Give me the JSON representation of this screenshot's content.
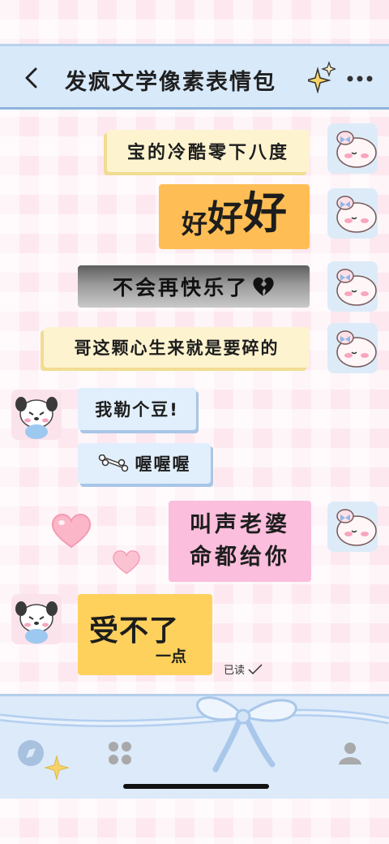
{
  "header": {
    "title": "发疯文学像素表情包"
  },
  "messages": [
    {
      "side": "right",
      "text": "宝的冷酷零下八度"
    },
    {
      "side": "right",
      "text_small": "好",
      "text_mid": "好",
      "text_big": "好"
    },
    {
      "side": "right",
      "text": "不会再快乐了",
      "icon": "broken-heart-icon"
    },
    {
      "side": "right",
      "text": "哥这颗心生来就是要碎的"
    },
    {
      "side": "left",
      "text": "我勒个豆!"
    },
    {
      "side": "left",
      "text": "喔喔喔",
      "icon": "bone-icon"
    },
    {
      "side": "right",
      "line1": "叫声老婆",
      "line2": "命都给你"
    },
    {
      "side": "left",
      "line1": "受不了",
      "line2": "一点"
    }
  ],
  "status": {
    "read": "已读",
    "read_icon": "check-icon"
  },
  "colors": {
    "header_bg": "#d8e9fa",
    "cream_bubble": "#fdf3cf",
    "orange_bubble": "#ffbe55",
    "blue_bubble": "#e1eefb",
    "pink_bubble": "#fbbedc",
    "yellow_bubble": "#fdd15c"
  }
}
